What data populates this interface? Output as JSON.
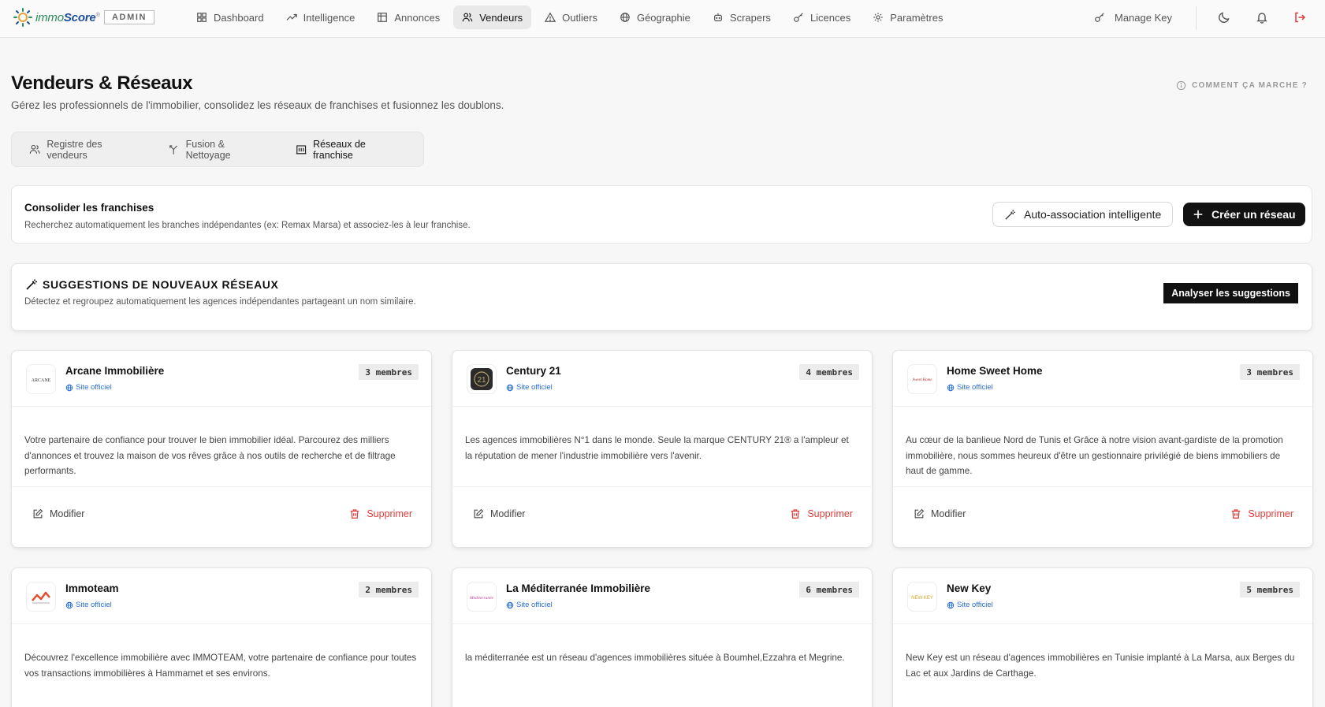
{
  "app": {
    "brand_part1": "immo",
    "brand_part2": "Score",
    "brand_mark": "®",
    "role_badge": "ADMIN"
  },
  "nav": [
    {
      "label": "Dashboard",
      "icon": "dashboard-icon"
    },
    {
      "label": "Intelligence",
      "icon": "trend-icon"
    },
    {
      "label": "Annonces",
      "icon": "table-icon"
    },
    {
      "label": "Vendeurs",
      "icon": "users-icon",
      "active": true
    },
    {
      "label": "Outliers",
      "icon": "warning-icon"
    },
    {
      "label": "Géographie",
      "icon": "globe-icon"
    },
    {
      "label": "Scrapers",
      "icon": "robot-icon"
    },
    {
      "label": "Licences",
      "icon": "key-icon"
    },
    {
      "label": "Paramètres",
      "icon": "gear-icon"
    }
  ],
  "topbar": {
    "manage_key": "Manage Key"
  },
  "header": {
    "title": "Vendeurs & Réseaux",
    "subtitle": "Gérez les professionnels de l'immobilier, consolidez les réseaux de franchises et fusionnez les doublons.",
    "help": "COMMENT ÇA MARCHE ?"
  },
  "tabs": [
    {
      "label": "Registre des vendeurs",
      "icon": "users-icon"
    },
    {
      "label": "Fusion & Nettoyage",
      "icon": "merge-icon"
    },
    {
      "label": "Réseaux de franchise",
      "icon": "building-icon",
      "active": true
    }
  ],
  "consolidate": {
    "title": "Consolider les franchises",
    "text": "Recherchez automatiquement les branches indépendantes (ex: Remax Marsa) et associez-les à leur franchise.",
    "auto_button": "Auto-association intelligente",
    "create_button": "Créer un réseau"
  },
  "suggestions": {
    "title": "SUGGESTIONS DE NOUVEAUX RÉSEAUX",
    "text": "Détectez et regroupez automatiquement les agences indépendantes partageant un nom similaire.",
    "button": "Analyser les suggestions"
  },
  "card_labels": {
    "site": "Site officiel",
    "edit": "Modifier",
    "delete": "Supprimer"
  },
  "cards": [
    {
      "name": "Arcane Immobilière",
      "members": "3 membres",
      "logo_text": "ARCANE",
      "description": "Votre partenaire de confiance pour trouver le bien immobilier idéal. Parcourez des milliers d'annonces et trouvez la maison de vos rêves grâce à nos outils de recherche et de filtrage performants."
    },
    {
      "name": "Century 21",
      "members": "4 membres",
      "logo_text": "21",
      "description": "Les agences immobilières N°1 dans le monde. Seule la marque CENTURY 21® a l'ampleur et la réputation de mener l'industrie immobilière vers l'avenir."
    },
    {
      "name": "Home Sweet Home",
      "members": "3 membres",
      "logo_text": "Sweet Home",
      "description": "Au cœur de la banlieue Nord de Tunis et Grâce à notre vision avant-gardiste de la promotion immobilière, nous sommes heureux d'être un gestionnaire privilégié de biens immobiliers de haut de gamme."
    },
    {
      "name": "Immoteam",
      "members": "2 membres",
      "logo_text": "",
      "description": "Découvrez l'excellence immobilière avec IMMOTEAM, votre partenaire de confiance pour toutes vos transactions immobilières à Hammamet et ses environs."
    },
    {
      "name": "La Méditerranée Immobilière",
      "members": "6 membres",
      "logo_text": "Méditerranée",
      "description": "la méditerranée est un réseau d'agences immobilières située à Boumhel,Ezzahra et Megrine."
    },
    {
      "name": "New Key",
      "members": "5 membres",
      "logo_text": "NEW KEY",
      "description": "New Key est un réseau d'agences immobilières en Tunisie implanté à La Marsa, aux Berges du Lac et aux Jardins de Carthage."
    }
  ],
  "colors": {
    "accent_link": "#2a6fd6",
    "danger": "#e03b3b",
    "dark_button": "#121212"
  }
}
